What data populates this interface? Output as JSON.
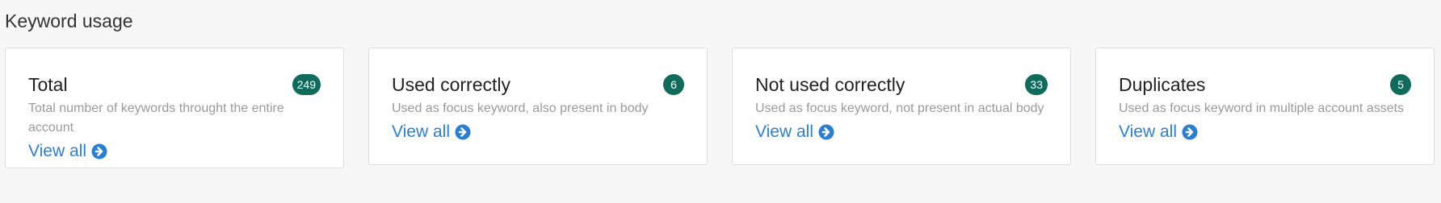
{
  "section": {
    "title": "Keyword usage"
  },
  "cards": [
    {
      "title": "Total",
      "count": "249",
      "description": "Total number of keywords throught the entire account",
      "link_label": "View all"
    },
    {
      "title": "Used correctly",
      "count": "6",
      "description": "Used as focus keyword, also present in body",
      "link_label": "View all"
    },
    {
      "title": "Not used correctly",
      "count": "33",
      "description": "Used as focus keyword, not present in actual body",
      "link_label": "View all"
    },
    {
      "title": "Duplicates",
      "count": "5",
      "description": "Used as focus keyword in multiple account assets",
      "link_label": "View all"
    }
  ],
  "colors": {
    "badge": "#0f6b5c",
    "link": "#2a7fd4",
    "description": "#9a9a9a"
  },
  "icons": {
    "view_all": "arrow-circle-right-icon"
  }
}
